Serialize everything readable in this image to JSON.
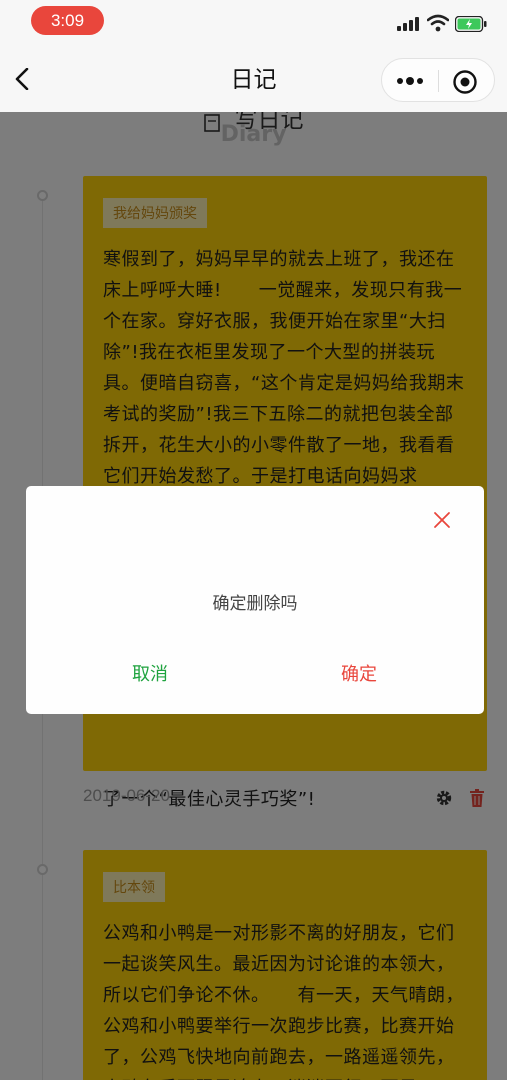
{
  "status_bar": {
    "time": "3:09"
  },
  "nav": {
    "title": "日记"
  },
  "page": {
    "heading": "写日记",
    "subheading": "Diary"
  },
  "entries": [
    {
      "tag": "我给妈妈颁奖",
      "text_visible_top": "寒假到了，妈妈早早的就去上班了，我还在床上呼呼大睡!　　一觉醒来，发现只有我一个在家。穿好衣服，我便开始在家里“大扫除”!我在衣柜里发现了一个大型的拼装玩具。便暗自窃喜，“这个肯定是妈妈给我期末考试的奖励”!我三下五除二的就把包装全部拆开，花生大小的小零件散了一地，我看看它们开始发愁了。于是打电话向妈妈求",
      "text_visible_bottom": "了一个“最佳心灵手巧奖”!",
      "date": "2019-06-20"
    },
    {
      "tag": "比本领",
      "text_visible_top": "公鸡和小鸭是一对形影不离的好朋友，它们一起谈笑风生。最近因为讨论谁的本领大，所以它们争论不休。　　有一天，天气晴朗，公鸡和小鸭要举行一次跑步比赛，比赛开始了，公鸡飞快地向前跑去，一路遥遥领先，小鸭在后面跟是追上，迷迷不行，可是"
    }
  ],
  "dialog": {
    "message": "确定删除吗",
    "cancel_label": "取消",
    "confirm_label": "确定"
  },
  "colors": {
    "card_bg": "#ffd20a",
    "tag_bg": "#fff2b5",
    "cancel": "#1fa33f",
    "confirm": "#e9463c",
    "status_pill": "#e9463c"
  }
}
